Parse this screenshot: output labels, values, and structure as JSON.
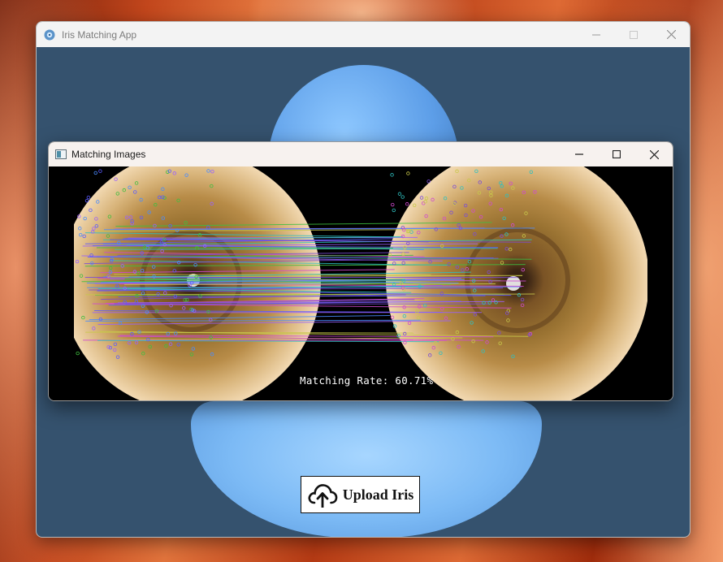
{
  "main_window": {
    "title": "Iris Matching App",
    "controls": [
      "minimize",
      "maximize",
      "close"
    ]
  },
  "upload": {
    "label": "Upload Iris",
    "icon": "cloud-upload-icon"
  },
  "match_window": {
    "title": "Matching Images",
    "controls": [
      "minimize",
      "maximize",
      "close"
    ],
    "matching_rate_text": "Matching Rate: 60.71%"
  },
  "colors": {
    "window_bg": "#35526e",
    "titlebar": "#f3f3f3",
    "bust": "#7cbaf5"
  }
}
